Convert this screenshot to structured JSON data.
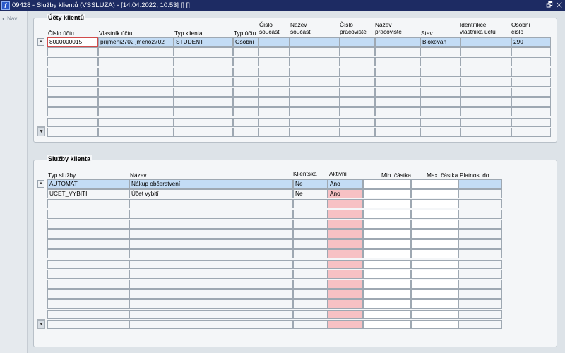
{
  "window": {
    "title": "09428 - Služby klientů (VSSLUZA) - [14.04.2022; 10:53]  []  []",
    "app_icon": "ƒ",
    "controls": "🗗 ✕"
  },
  "sidebar": {
    "nav_label": "Nav",
    "nav_icon": "◐"
  },
  "accounts_panel": {
    "title": "Účty klientů",
    "headers": {
      "cislo_uctu": "Číslo účtu",
      "vlastnik": "Vlastník účtu",
      "typ_klienta": "Typ klienta",
      "typ_uctu": "Typ účtu",
      "cislo_soucasti": "Číslo\nsoučásti",
      "nazev_soucasti": "Název\nsoučásti",
      "cislo_pracoviste": "Číslo\npracoviště",
      "nazev_pracoviste": "Název\npracoviště",
      "stav": "Stav",
      "identifikace": "Identifikce\nvlastníka účtu",
      "osobni_cislo": "Osobní\nčíslo"
    },
    "rows": [
      {
        "cislo_uctu": "8000000015",
        "vlastnik": "prijmeni2702 jmeno2702",
        "typ_klienta": "STUDENT",
        "typ_uctu": "Osobní",
        "cislo_soucasti": "",
        "nazev_soucasti": "",
        "cislo_pracoviste": "",
        "nazev_pracoviste": "",
        "stav": "Blokován",
        "identifikace": "",
        "osobni_cislo": "290"
      }
    ]
  },
  "services_panel": {
    "title": "Služby klienta",
    "headers": {
      "typ_sluzby": "Typ služby",
      "nazev": "Název",
      "klientska": "Klientská",
      "aktivni": "Aktivní",
      "min_castka": "Min. částka",
      "max_castka": "Max. částka",
      "platnost_do": "Platnost do"
    },
    "rows": [
      {
        "typ_sluzby": "AUTOMAT",
        "nazev": "Nákup občerstvení",
        "klientska": "Ne",
        "aktivni": "Ano",
        "min_castka": "",
        "max_castka": "",
        "platnost_do": ""
      },
      {
        "typ_sluzby": "UCET_VYBITI",
        "nazev": "Účet vybití",
        "klientska": "Ne",
        "aktivni": "Ano",
        "min_castka": "",
        "max_castka": "",
        "platnost_do": ""
      }
    ]
  }
}
